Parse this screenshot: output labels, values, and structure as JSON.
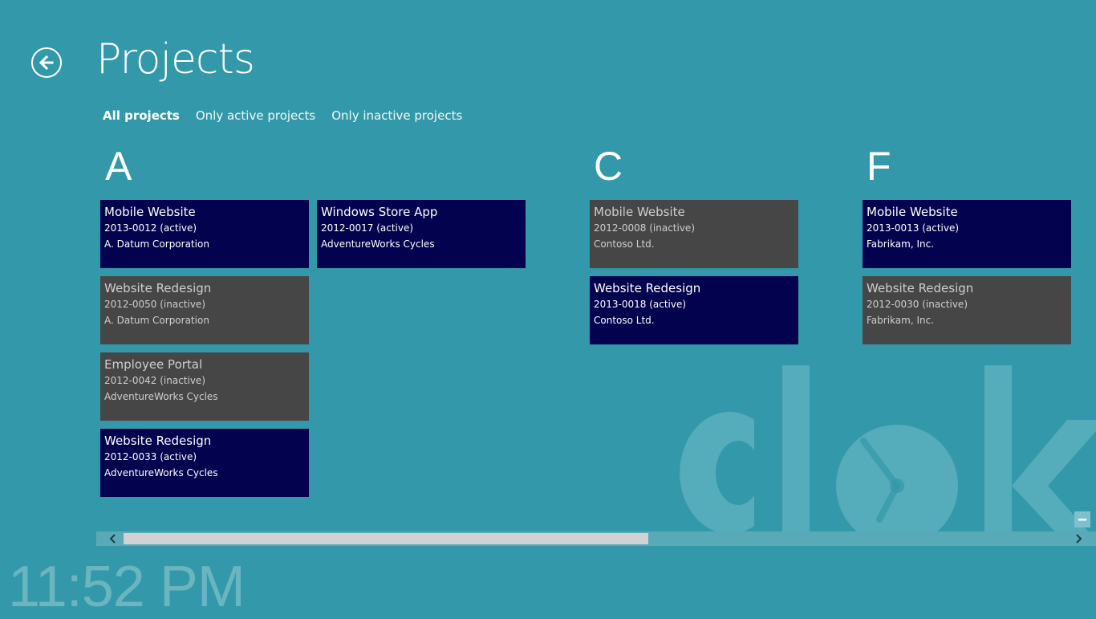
{
  "header": {
    "title": "Projects"
  },
  "filters": [
    {
      "label": "All projects",
      "selected": true
    },
    {
      "label": "Only active projects",
      "selected": false
    },
    {
      "label": "Only inactive projects",
      "selected": false
    }
  ],
  "groups": [
    {
      "letter": "A",
      "projects": [
        {
          "name": "Mobile Website",
          "number": "2013-0012 (active)",
          "client": "A. Datum Corporation",
          "status": "active"
        },
        {
          "name": "Website Redesign",
          "number": "2012-0050 (inactive)",
          "client": "A. Datum Corporation",
          "status": "inactive"
        },
        {
          "name": "Employee Portal",
          "number": "2012-0042 (inactive)",
          "client": "AdventureWorks Cycles",
          "status": "inactive"
        },
        {
          "name": "Website Redesign",
          "number": "2012-0033 (active)",
          "client": "AdventureWorks Cycles",
          "status": "active"
        },
        {
          "name": "Windows Store App",
          "number": "2012-0017 (active)",
          "client": "AdventureWorks Cycles",
          "status": "active"
        }
      ]
    },
    {
      "letter": "C",
      "projects": [
        {
          "name": "Mobile Website",
          "number": "2012-0008 (inactive)",
          "client": "Contoso Ltd.",
          "status": "inactive"
        },
        {
          "name": "Website Redesign",
          "number": "2013-0018 (active)",
          "client": "Contoso Ltd.",
          "status": "active"
        }
      ]
    },
    {
      "letter": "F",
      "projects": [
        {
          "name": "Mobile Website",
          "number": "2013-0013 (active)",
          "client": "Fabrikam, Inc.",
          "status": "active"
        },
        {
          "name": "Website Redesign",
          "number": "2012-0030 (inactive)",
          "client": "Fabrikam, Inc.",
          "status": "inactive"
        }
      ]
    }
  ],
  "watermark": {
    "text": "clok"
  },
  "clock": {
    "time": "11:52 PM"
  },
  "icons": {
    "back": "back-arrow-icon",
    "scroll_left": "chevron-left-icon",
    "scroll_right": "chevron-right-icon",
    "zoom": "minus-icon",
    "logo_clock": "clock-icon"
  },
  "colors": {
    "background": "#3399aa",
    "active_tile": "#02024e",
    "inactive_tile": "#464646",
    "scroll_thumb": "#d2d2d2"
  }
}
